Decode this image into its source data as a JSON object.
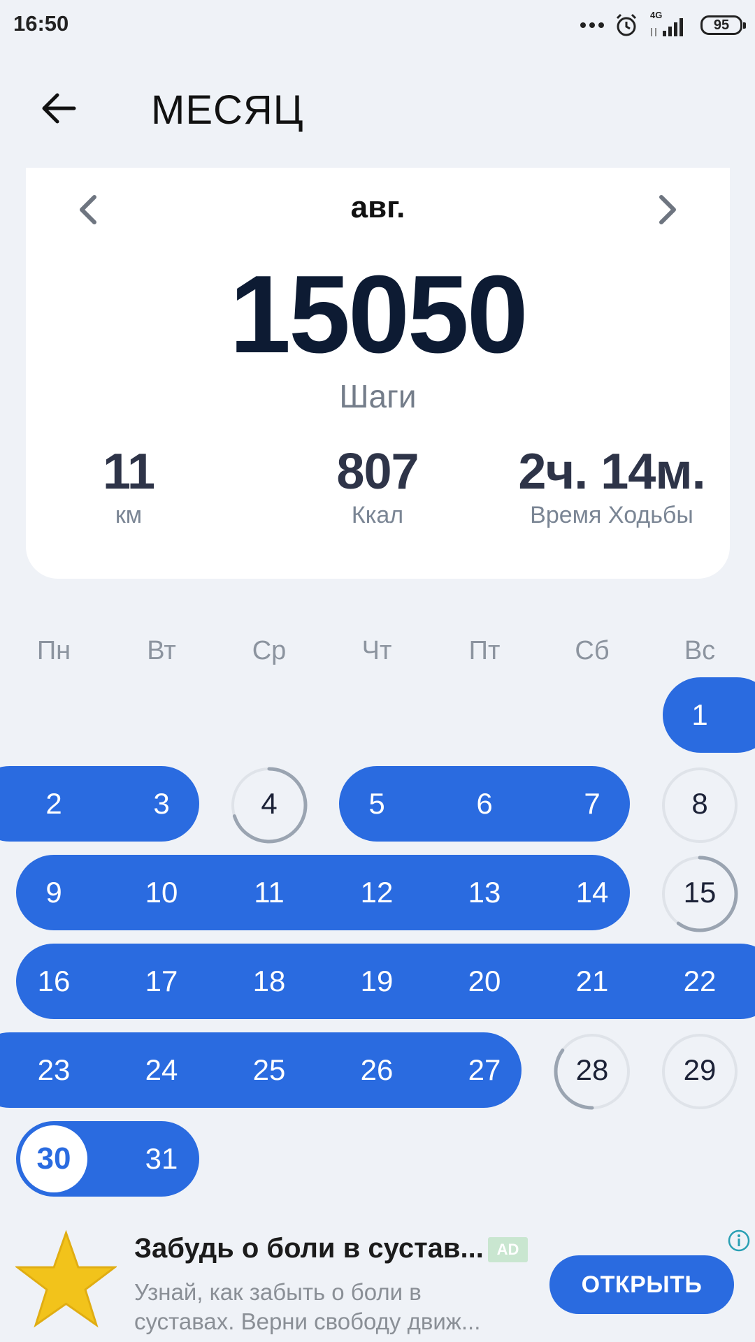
{
  "status_bar": {
    "time": "16:50",
    "network": "4G",
    "battery": "95"
  },
  "header": {
    "title": "МЕСЯЦ"
  },
  "summary": {
    "month": "авг.",
    "steps": "15050",
    "steps_label": "Шаги",
    "stats": [
      {
        "value": "11",
        "label": "км"
      },
      {
        "value": "807",
        "label": "Ккал"
      },
      {
        "value": "2ч. 14м.",
        "label": "Время Ходьбы"
      }
    ]
  },
  "calendar": {
    "weekdays": [
      "Пн",
      "Вт",
      "Ср",
      "Чт",
      "Пт",
      "Сб",
      "Вс"
    ],
    "days": [
      "1",
      "2",
      "3",
      "4",
      "5",
      "6",
      "7",
      "8",
      "9",
      "10",
      "11",
      "12",
      "13",
      "14",
      "15",
      "16",
      "17",
      "18",
      "19",
      "20",
      "21",
      "22",
      "23",
      "24",
      "25",
      "26",
      "27",
      "28",
      "29",
      "30",
      "31"
    ],
    "completed_days": [
      1,
      2,
      3,
      5,
      6,
      7,
      9,
      10,
      11,
      12,
      13,
      14,
      16,
      17,
      18,
      19,
      20,
      21,
      22,
      23,
      24,
      25,
      26,
      27,
      31
    ],
    "partial_progress": {
      "4": 0.7,
      "15": 0.6,
      "28": 0.35,
      "8": 0.0,
      "29": 0.0
    },
    "today": "30"
  },
  "ad": {
    "title": "Забудь о боли в сустав...",
    "badge": "AD",
    "description": "Узнай, как забыть о боли в суставах. Верни свободу движ...",
    "button": "ОТКРЫТЬ"
  },
  "colors": {
    "accent": "#2a6be0",
    "background": "#eff2f7",
    "ring": "#9aa4b1",
    "star": "#f2c31b"
  }
}
